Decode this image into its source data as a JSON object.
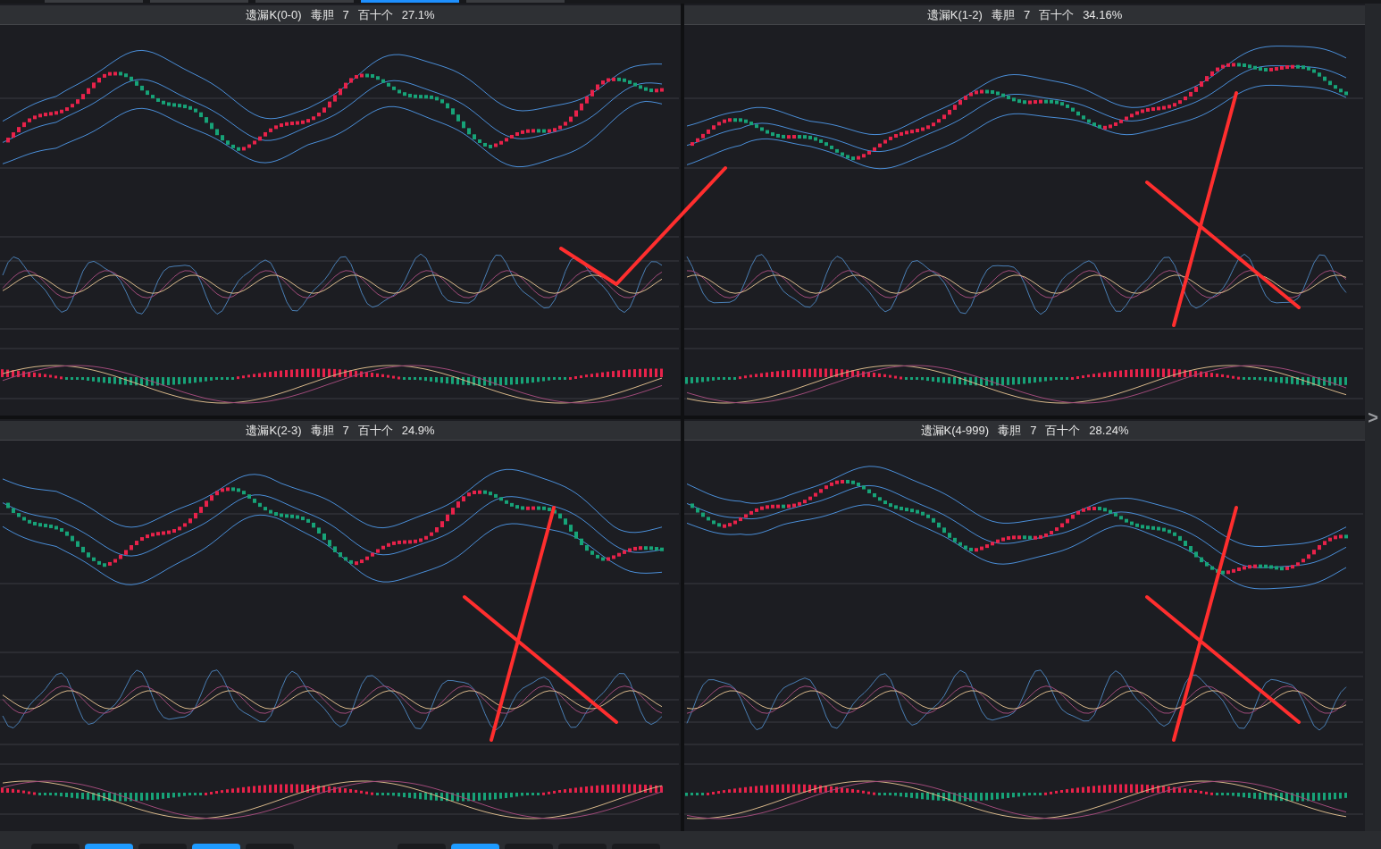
{
  "top_tabs": [
    {
      "selected": false
    },
    {
      "selected": false
    },
    {
      "selected": false
    },
    {
      "selected": true
    },
    {
      "selected": false
    }
  ],
  "panels": [
    {
      "name": "遗漏K(0-0)",
      "label": "毒胆",
      "count": "7",
      "digits": "百十个",
      "rate": "27.1%"
    },
    {
      "name": "遗漏K(1-2)",
      "label": "毒胆",
      "count": "7",
      "digits": "百十个",
      "rate": "34.16%"
    },
    {
      "name": "遗漏K(2-3)",
      "label": "毒胆",
      "count": "7",
      "digits": "百十个",
      "rate": "24.9%"
    },
    {
      "name": "遗漏K(4-999)",
      "label": "毒胆",
      "count": "7",
      "digits": "百十个",
      "rate": "28.24%"
    }
  ],
  "side_arrow": ">",
  "bottom_tabs": [
    {
      "selected": false
    },
    {
      "selected": true
    },
    {
      "selected": false
    },
    {
      "selected": true
    },
    {
      "selected": false
    },
    {
      "selected": false
    },
    {
      "selected": true
    },
    {
      "selected": false
    },
    {
      "selected": false
    },
    {
      "selected": false
    }
  ]
}
